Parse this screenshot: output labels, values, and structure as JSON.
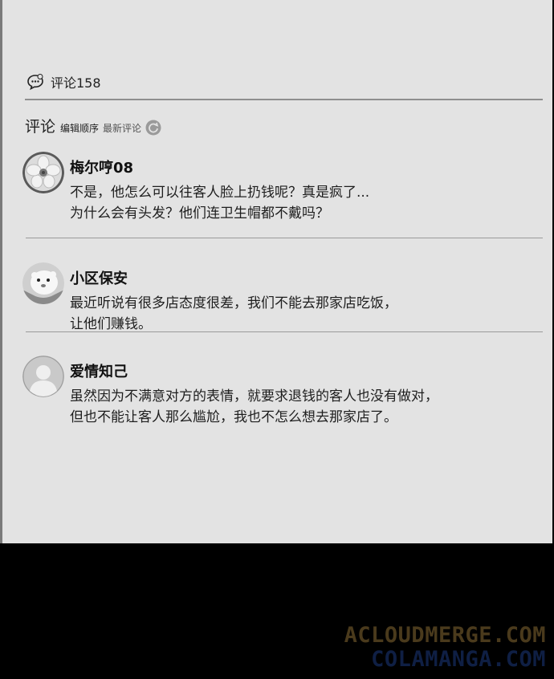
{
  "comments_section": {
    "count_label": "评论158",
    "sort_title": "评论",
    "sort_options": [
      "编辑顺序",
      "最新评论"
    ]
  },
  "comments": [
    {
      "username": "梅尔哼08",
      "lines": [
        "不是，他怎么可以往客人脸上扔钱呢？真是疯了...",
        "为什么会有头发？他们连卫生帽都不戴吗？"
      ]
    },
    {
      "username": "小区保安",
      "lines": [
        "最近听说有很多店态度很差，我们不能去那家店吃饭，",
        "让他们赚钱。"
      ]
    },
    {
      "username": "爱情知己",
      "lines": [
        "虽然因为不满意对方的表情，就要求退钱的客人也没有做对，",
        "但也不能让客人那么尴尬，我也不怎么想去那家店了。"
      ]
    }
  ],
  "watermark": {
    "line1": "ACLOUDMERGE.COM",
    "line2": "COLAMANGA.COM"
  },
  "icons": {
    "count": "chat-bubble-icon",
    "refresh": "refresh-icon",
    "avatar1": "flower-avatar-icon",
    "avatar2": "cartoon-face-avatar-icon",
    "avatar3": "default-user-avatar-icon"
  }
}
